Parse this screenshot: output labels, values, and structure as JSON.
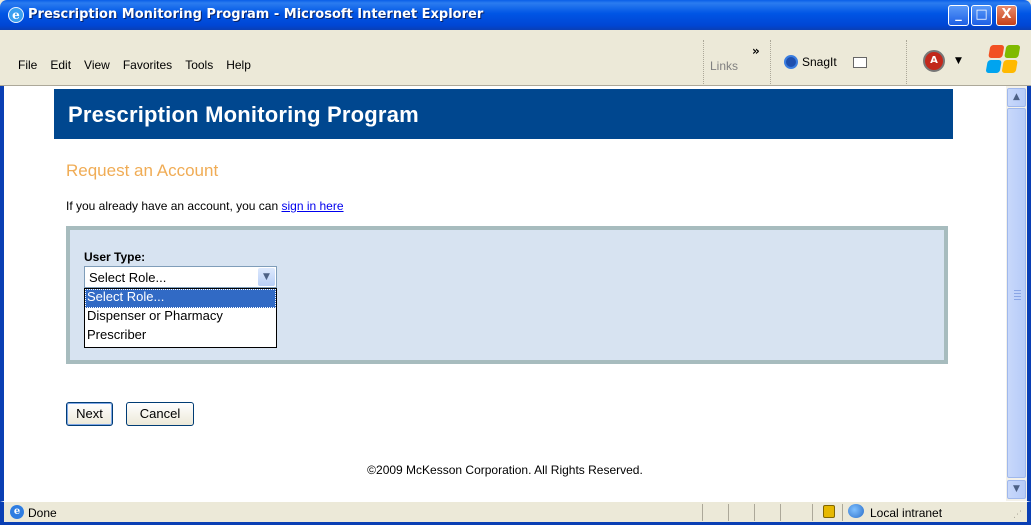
{
  "window": {
    "title": "Prescription Monitoring Program - Microsoft Internet Explorer",
    "minimize": "_",
    "maximize": "□",
    "close": "X"
  },
  "menubar": {
    "items": [
      "File",
      "Edit",
      "View",
      "Favorites",
      "Tools",
      "Help"
    ],
    "links_label": "Links",
    "chevron": "»",
    "snagit_label": "SnagIt"
  },
  "page": {
    "header": "Prescription Monitoring Program",
    "request_title": "Request an Account",
    "signin_prefix": "If you already have an account, you can ",
    "signin_link": "sign in here",
    "user_type_label": "User Type:",
    "select_value": "Select Role...",
    "dropdown_options": [
      "Select Role...",
      "Dispenser or Pharmacy",
      "Prescriber"
    ],
    "next_button": "Next",
    "cancel_button": "Cancel",
    "footer": "©2009 McKesson Corporation. All Rights Reserved."
  },
  "statusbar": {
    "status": "Done",
    "zone": "Local intranet"
  },
  "colors": {
    "header_band": "#00478f",
    "request_title": "#f0ac55",
    "panel_bg": "#d7e3f1",
    "panel_border": "#a7bcbe",
    "selected_option": "#316ac5"
  }
}
